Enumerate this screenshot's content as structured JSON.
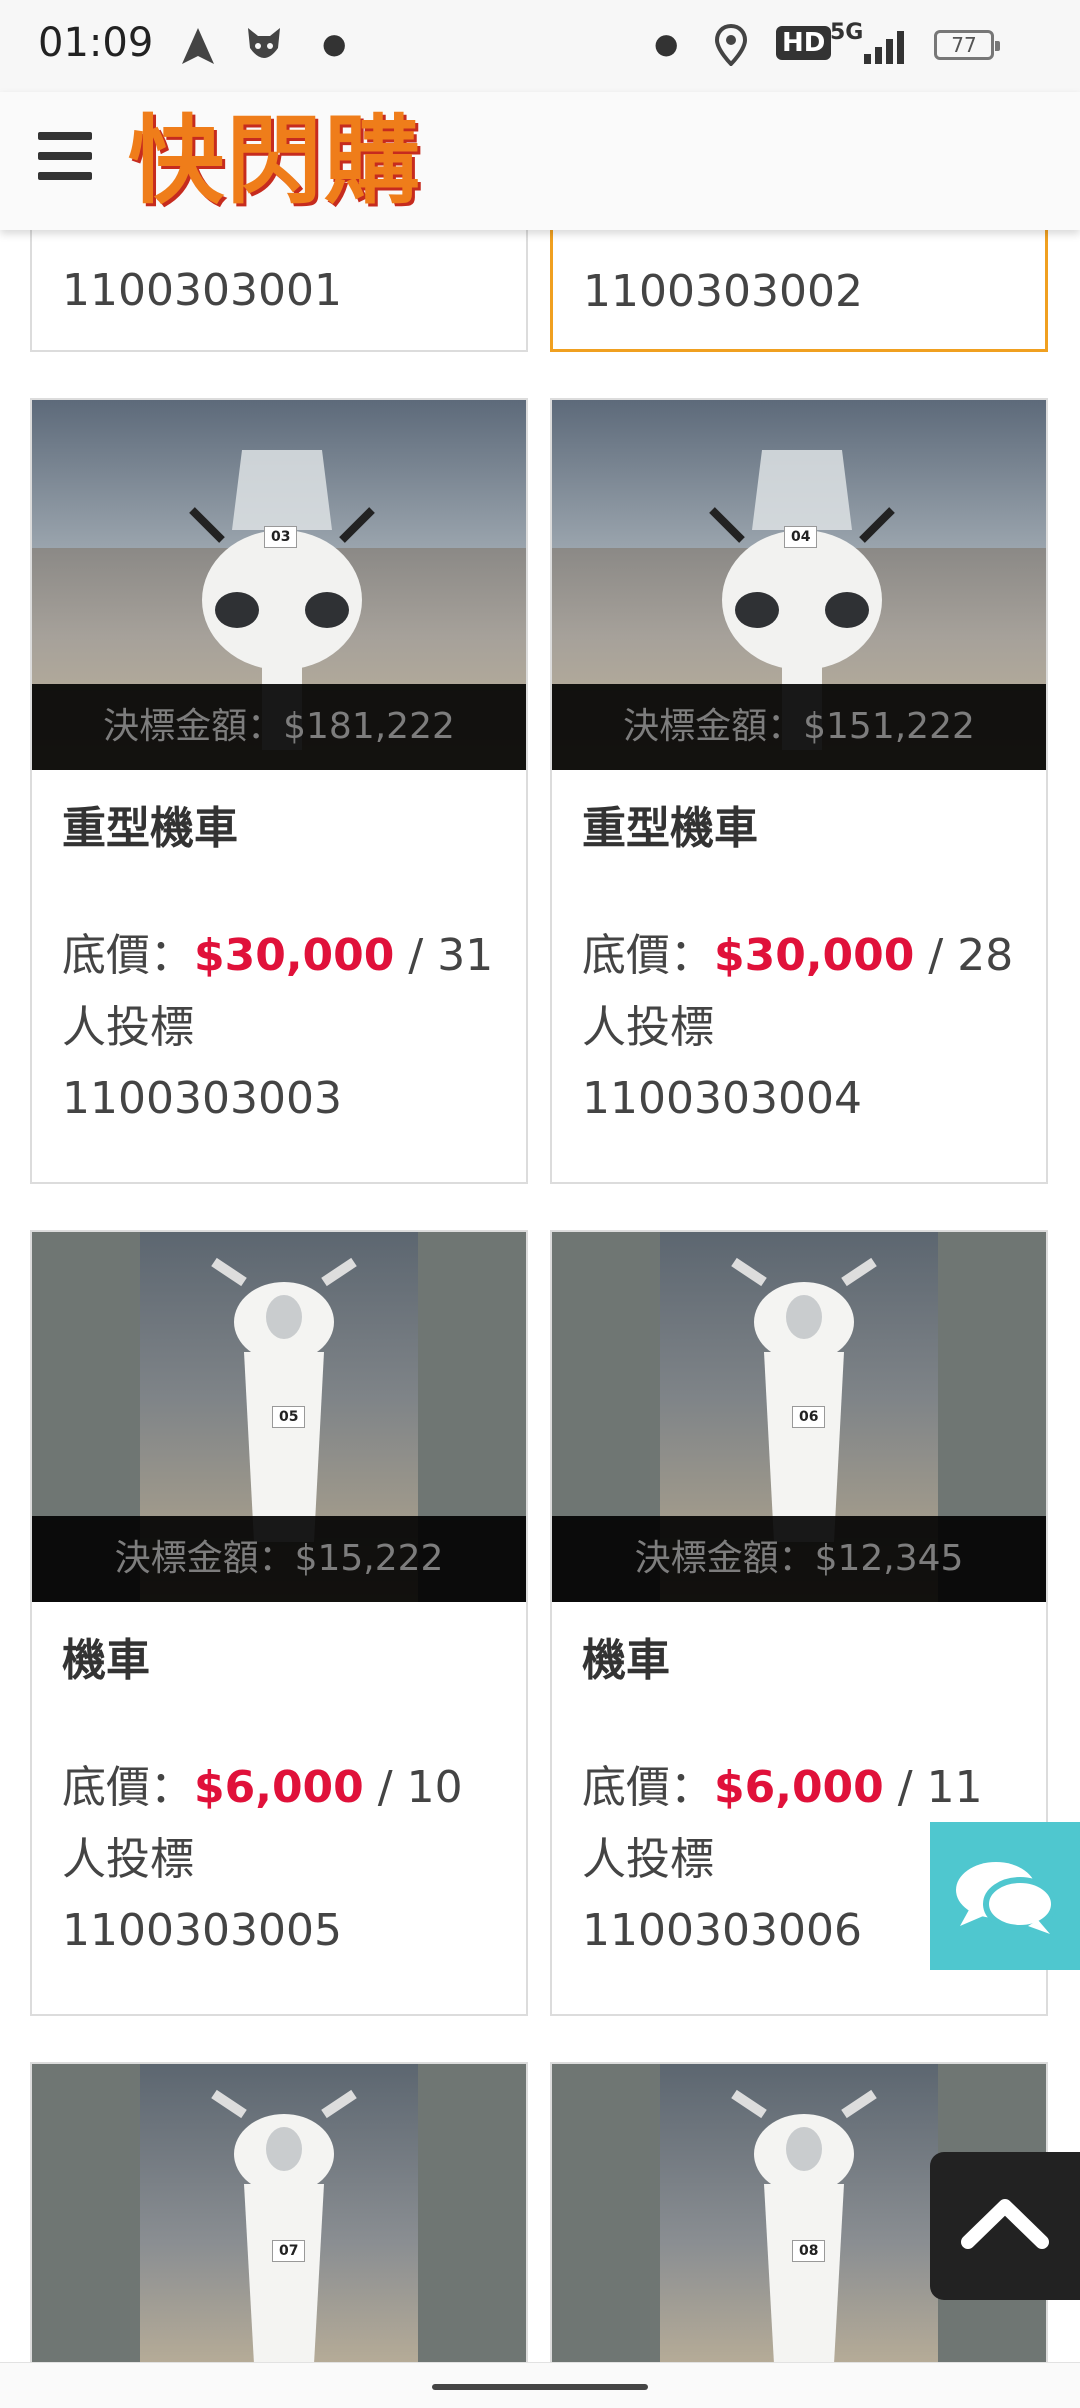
{
  "status_bar": {
    "time": "01:09",
    "network": "5G",
    "hd": "HD",
    "battery": "77"
  },
  "header": {
    "logo_text": "快閃購"
  },
  "top_partial_cards": [
    {
      "code": "1100303001",
      "highlight": false
    },
    {
      "code": "1100303002",
      "highlight": true
    }
  ],
  "cards": [
    {
      "tag": "03",
      "final_price_label": "決標金額：$181,222",
      "title": "重型機車",
      "base_label": "底價：",
      "base_price": "$30,000",
      "bidders_suffix": " / 31",
      "bidders_line2": "人投標",
      "code": "1100303003"
    },
    {
      "tag": "04",
      "final_price_label": "決標金額：$151,222",
      "title": "重型機車",
      "base_label": "底價：",
      "base_price": "$30,000",
      "bidders_suffix": " / 28",
      "bidders_line2": "人投標",
      "code": "1100303004"
    },
    {
      "tag": "05",
      "final_price_label": "決標金額：$15,222",
      "title": "機車",
      "base_label": "底價：",
      "base_price": "$6,000",
      "bidders_suffix": " / 10",
      "bidders_line2": "人投標",
      "code": "1100303005"
    },
    {
      "tag": "06",
      "final_price_label": "決標金額：$12,345",
      "title": "機車",
      "base_label": "底價：",
      "base_price": "$6,000",
      "bidders_suffix": " / 11",
      "bidders_line2": "人投標",
      "code": "1100303006"
    }
  ],
  "bottom_partial_cards": [
    {
      "tag": "07"
    },
    {
      "tag": "08"
    }
  ],
  "icons": {
    "chat": "chat-icon",
    "scroll_top": "chevron-up-icon",
    "menu": "hamburger-icon"
  },
  "colors": {
    "price_red": "#e0113a",
    "highlight_border": "#f0a020",
    "chat_button": "#4fc7cf",
    "logo_orange": "#ef7d1a"
  }
}
